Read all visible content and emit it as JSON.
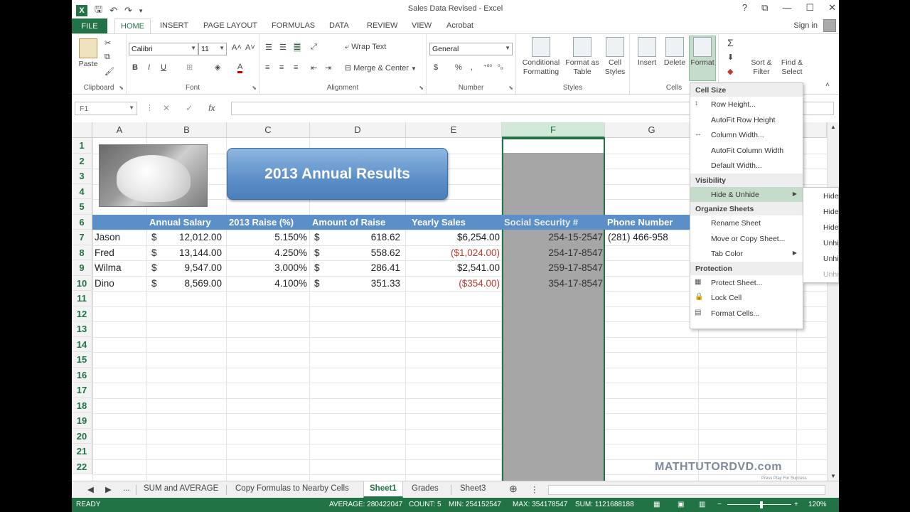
{
  "window": {
    "title": "Sales Data Revised - Excel",
    "controls": [
      "?",
      "⧉",
      "—",
      "☐",
      "✕"
    ]
  },
  "qat": {
    "app_icon": "X",
    "save": "save-icon",
    "undo": "undo-icon",
    "redo": "redo-icon"
  },
  "ribbon_tabs": {
    "file": "FILE",
    "tabs": [
      "HOME",
      "INSERT",
      "PAGE LAYOUT",
      "FORMULAS",
      "DATA",
      "REVIEW",
      "VIEW",
      "Acrobat"
    ],
    "active": "HOME",
    "sign_in": "Sign in"
  },
  "ribbon": {
    "clipboard": {
      "paste": "Paste",
      "label": "Clipboard"
    },
    "font": {
      "name": "Calibri",
      "size": "11",
      "bold": "B",
      "italic": "I",
      "underline": "U",
      "label": "Font"
    },
    "alignment": {
      "wrap": "Wrap Text",
      "merge": "Merge & Center",
      "label": "Alignment"
    },
    "number": {
      "format": "General",
      "currency": "$",
      "percent": "%",
      "comma": ",",
      "label": "Number"
    },
    "styles": {
      "conditional": "Conditional Formatting",
      "format_table": "Format as Table",
      "cell_styles": "Cell Styles",
      "label": "Styles"
    },
    "cells": {
      "insert": "Insert",
      "delete": "Delete",
      "format": "Format",
      "label": "Cells"
    },
    "editing": {
      "sort": "Sort & Filter",
      "find": "Find & Select",
      "sigma": "Σ"
    }
  },
  "formula_bar": {
    "name_box": "F1",
    "cancel": "✕",
    "enter": "✓",
    "fx": "fx",
    "value": ""
  },
  "columns": [
    "A",
    "B",
    "C",
    "D",
    "E",
    "F",
    "G"
  ],
  "rows": [
    "1",
    "2",
    "3",
    "4",
    "5",
    "6",
    "7",
    "8",
    "9",
    "10",
    "11",
    "12",
    "13",
    "14",
    "15",
    "16",
    "17",
    "18",
    "19",
    "20",
    "21",
    "22"
  ],
  "banner_title": "2013 Annual Results",
  "headers": [
    "Annual Salary",
    "2013 Raise (%)",
    "Amount of Raise",
    "Yearly Sales",
    "Social Security #",
    "Phone Number"
  ],
  "data_rows": [
    {
      "name": "Jason",
      "cur": "$",
      "salary": "12,012.00",
      "raise_pct": "5.150%",
      "cur2": "$",
      "raise_amt": "618.62",
      "sales": "$6,254.00",
      "ssn": "254-15-2547",
      "phone": "(281) 466-958"
    },
    {
      "name": "Fred",
      "cur": "$",
      "salary": "13,144.00",
      "raise_pct": "4.250%",
      "cur2": "$",
      "raise_amt": "558.62",
      "sales": "($1,024.00)",
      "ssn": "254-17-8547",
      "phone": ""
    },
    {
      "name": "Wilma",
      "cur": "$",
      "salary": "9,547.00",
      "raise_pct": "3.000%",
      "cur2": "$",
      "raise_amt": "286.41",
      "sales": "$2,541.00",
      "ssn": "259-17-8547",
      "phone": ""
    },
    {
      "name": "Dino",
      "cur": "$",
      "salary": "8,569.00",
      "raise_pct": "4.100%",
      "cur2": "$",
      "raise_amt": "351.33",
      "sales": "($354.00)",
      "ssn": "354-17-8547",
      "phone": ""
    }
  ],
  "format_menu": {
    "sections": {
      "cell_size": "Cell Size",
      "visibility": "Visibility",
      "organize": "Organize Sheets",
      "protection": "Protection"
    },
    "items": {
      "row_height": "Row Height...",
      "autofit_row": "AutoFit Row Height",
      "column_width": "Column Width...",
      "autofit_column": "AutoFit Column Width",
      "default_width": "Default Width...",
      "hide_unhide": "Hide & Unhide",
      "rename": "Rename Sheet",
      "move_copy": "Move or Copy Sheet...",
      "tab_color": "Tab Color",
      "protect": "Protect Sheet...",
      "lock": "Lock Cell",
      "format_cells": "Format Cells..."
    },
    "submenu": [
      "Hide",
      "Hide",
      "Hide",
      "Unhi",
      "Unhi",
      "Unhi"
    ]
  },
  "sheet_tabs": {
    "nav": [
      "◀",
      "▶",
      "..."
    ],
    "tabs": [
      "SUM and AVERAGE",
      "Copy Formulas to Nearby Cells",
      "Sheet1",
      "Grades",
      "Sheet3"
    ],
    "active": "Sheet1",
    "add": "⊕"
  },
  "status": {
    "ready": "READY",
    "average": "AVERAGE: 280422047",
    "count": "COUNT: 5",
    "min": "MIN: 254152547",
    "max": "MAX: 354178547",
    "sum": "SUM: 1121688188",
    "zoom": "120%"
  },
  "watermark": {
    "main": "MATHTUTORDVD.com",
    "sub": "Press Play For Success"
  },
  "colors": {
    "excel_green": "#217346",
    "header_band": "#5b8fc7",
    "selected_col": "#a6a6a6",
    "negative": "#c0392b"
  }
}
